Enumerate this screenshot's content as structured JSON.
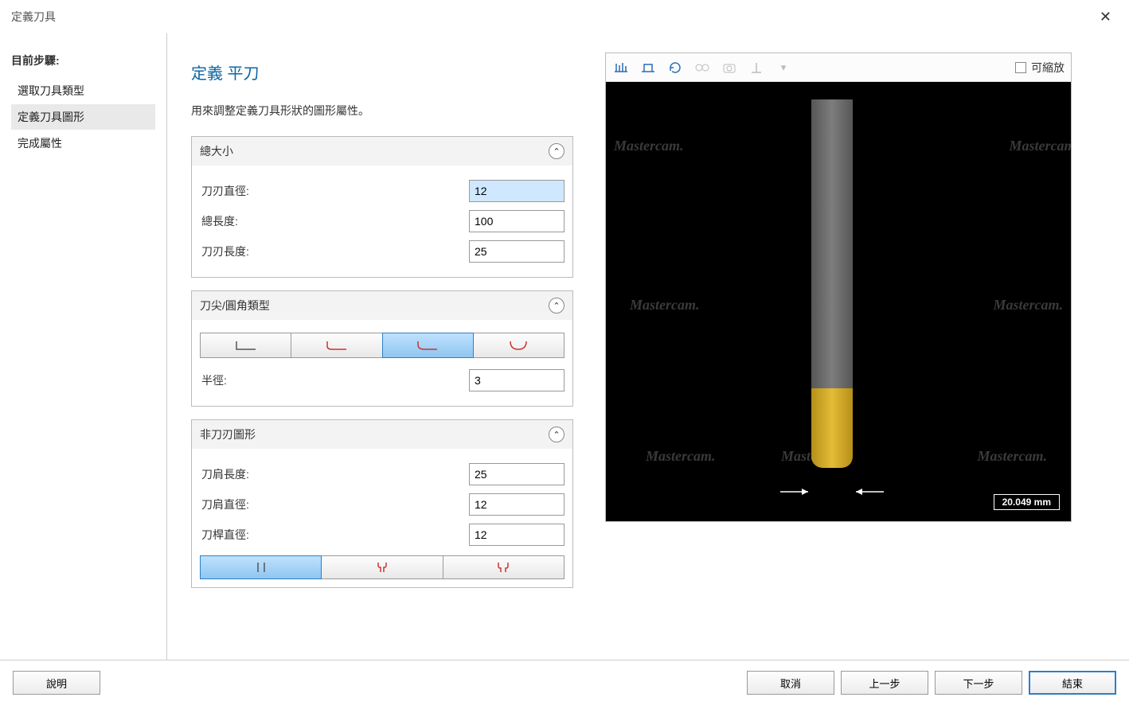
{
  "title": "定義刀具",
  "sidebar": {
    "heading": "目前步驟:",
    "items": [
      {
        "label": "選取刀具類型"
      },
      {
        "label": "定義刀具圖形"
      },
      {
        "label": "完成屬性"
      }
    ]
  },
  "page": {
    "heading": "定義 平刀",
    "description": "用來調整定義刀具形狀的圖形屬性。"
  },
  "panels": {
    "overall": {
      "title": "總大小",
      "diameter_label": "刀刃直徑:",
      "diameter": "12",
      "total_length_label": "總長度:",
      "total_length": "100",
      "flute_length_label": "刀刃長度:",
      "flute_length": "25"
    },
    "tip": {
      "title": "刀尖/圓角類型",
      "radius_label": "半徑:",
      "radius": "3",
      "options": [
        "flat",
        "corner-chamfer",
        "corner-radius",
        "ball"
      ],
      "selected_index": 2
    },
    "nonflute": {
      "title": "非刀刃圖形",
      "shoulder_len_label": "刀肩長度:",
      "shoulder_len": "25",
      "shoulder_dia_label": "刀肩直徑:",
      "shoulder_dia": "12",
      "shank_dia_label": "刀桿直徑:",
      "shank_dia": "12",
      "shank_options": [
        "straight",
        "neck-tapered",
        "step"
      ],
      "shank_selected_index": 0
    }
  },
  "preview": {
    "zoomable_label": "可縮放",
    "scale_label": "20.049 mm"
  },
  "footer": {
    "help": "說明",
    "cancel": "取消",
    "prev": "上一步",
    "next": "下一步",
    "finish": "結束"
  }
}
